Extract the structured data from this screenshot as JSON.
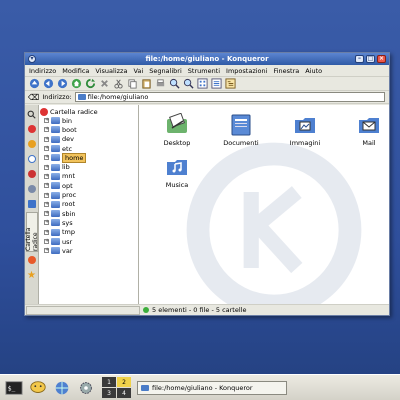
{
  "window": {
    "title": "file:/home/giuliano - Konqueror"
  },
  "menubar": [
    "Indirizzo",
    "Modifica",
    "Visualizza",
    "Vai",
    "Segnalibri",
    "Strumenti",
    "Impostazioni",
    "Finestra",
    "Aiuto"
  ],
  "toolbar": {
    "icons": [
      "up-icon",
      "back-icon",
      "forward-icon",
      "home-icon",
      "reload-icon",
      "stop-icon",
      "cut-icon",
      "copy-icon",
      "paste-icon",
      "print-icon",
      "zoom-in-icon",
      "zoom-out-icon",
      "view-icon-icon",
      "view-list-icon",
      "view-tree-icon"
    ]
  },
  "address": {
    "label": "Indirizzo:",
    "value": "file:/home/giuliano"
  },
  "tree": {
    "root": "Cartella radice",
    "items": [
      {
        "label": "bin",
        "selected": false
      },
      {
        "label": "boot",
        "selected": false
      },
      {
        "label": "dev",
        "selected": false
      },
      {
        "label": "etc",
        "selected": false
      },
      {
        "label": "home",
        "selected": true
      },
      {
        "label": "lib",
        "selected": false
      },
      {
        "label": "mnt",
        "selected": false
      },
      {
        "label": "opt",
        "selected": false
      },
      {
        "label": "proc",
        "selected": false
      },
      {
        "label": "root",
        "selected": false
      },
      {
        "label": "sbin",
        "selected": false
      },
      {
        "label": "sys",
        "selected": false
      },
      {
        "label": "tmp",
        "selected": false
      },
      {
        "label": "usr",
        "selected": false
      },
      {
        "label": "var",
        "selected": false
      }
    ]
  },
  "sidetab_label": "Cartella radice",
  "files": [
    {
      "label": "Desktop",
      "icon": "desktop-folder-icon"
    },
    {
      "label": "Documenti",
      "icon": "documents-folder-icon"
    },
    {
      "label": "Immagini",
      "icon": "images-folder-icon"
    },
    {
      "label": "Mail",
      "icon": "mail-folder-icon"
    },
    {
      "label": "Musica",
      "icon": "music-folder-icon"
    }
  ],
  "status": {
    "text": "5 elementi - 0 file - 5 cartelle"
  },
  "taskbar": {
    "pager": [
      "1",
      "2",
      "3",
      "4"
    ],
    "active_desktop": "2",
    "task_title": "file:/home/giuliano - Konqueror"
  },
  "colors": {
    "desktop": "#2f4f9c",
    "titlebar": "#2f5aa6",
    "selection": "#f2c35c"
  }
}
